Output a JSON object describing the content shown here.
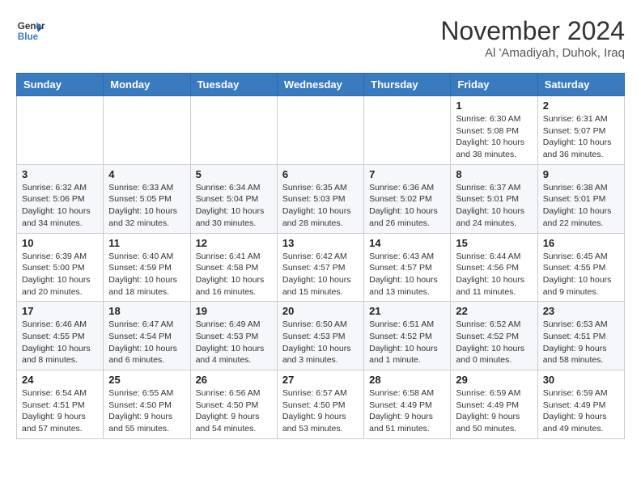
{
  "header": {
    "logo_line1": "General",
    "logo_line2": "Blue",
    "month_title": "November 2024",
    "subtitle": "Al 'Amadiyah, Duhok, Iraq"
  },
  "weekdays": [
    "Sunday",
    "Monday",
    "Tuesday",
    "Wednesday",
    "Thursday",
    "Friday",
    "Saturday"
  ],
  "weeks": [
    [
      {
        "day": "",
        "info": ""
      },
      {
        "day": "",
        "info": ""
      },
      {
        "day": "",
        "info": ""
      },
      {
        "day": "",
        "info": ""
      },
      {
        "day": "",
        "info": ""
      },
      {
        "day": "1",
        "info": "Sunrise: 6:30 AM\nSunset: 5:08 PM\nDaylight: 10 hours and 38 minutes."
      },
      {
        "day": "2",
        "info": "Sunrise: 6:31 AM\nSunset: 5:07 PM\nDaylight: 10 hours and 36 minutes."
      }
    ],
    [
      {
        "day": "3",
        "info": "Sunrise: 6:32 AM\nSunset: 5:06 PM\nDaylight: 10 hours and 34 minutes."
      },
      {
        "day": "4",
        "info": "Sunrise: 6:33 AM\nSunset: 5:05 PM\nDaylight: 10 hours and 32 minutes."
      },
      {
        "day": "5",
        "info": "Sunrise: 6:34 AM\nSunset: 5:04 PM\nDaylight: 10 hours and 30 minutes."
      },
      {
        "day": "6",
        "info": "Sunrise: 6:35 AM\nSunset: 5:03 PM\nDaylight: 10 hours and 28 minutes."
      },
      {
        "day": "7",
        "info": "Sunrise: 6:36 AM\nSunset: 5:02 PM\nDaylight: 10 hours and 26 minutes."
      },
      {
        "day": "8",
        "info": "Sunrise: 6:37 AM\nSunset: 5:01 PM\nDaylight: 10 hours and 24 minutes."
      },
      {
        "day": "9",
        "info": "Sunrise: 6:38 AM\nSunset: 5:01 PM\nDaylight: 10 hours and 22 minutes."
      }
    ],
    [
      {
        "day": "10",
        "info": "Sunrise: 6:39 AM\nSunset: 5:00 PM\nDaylight: 10 hours and 20 minutes."
      },
      {
        "day": "11",
        "info": "Sunrise: 6:40 AM\nSunset: 4:59 PM\nDaylight: 10 hours and 18 minutes."
      },
      {
        "day": "12",
        "info": "Sunrise: 6:41 AM\nSunset: 4:58 PM\nDaylight: 10 hours and 16 minutes."
      },
      {
        "day": "13",
        "info": "Sunrise: 6:42 AM\nSunset: 4:57 PM\nDaylight: 10 hours and 15 minutes."
      },
      {
        "day": "14",
        "info": "Sunrise: 6:43 AM\nSunset: 4:57 PM\nDaylight: 10 hours and 13 minutes."
      },
      {
        "day": "15",
        "info": "Sunrise: 6:44 AM\nSunset: 4:56 PM\nDaylight: 10 hours and 11 minutes."
      },
      {
        "day": "16",
        "info": "Sunrise: 6:45 AM\nSunset: 4:55 PM\nDaylight: 10 hours and 9 minutes."
      }
    ],
    [
      {
        "day": "17",
        "info": "Sunrise: 6:46 AM\nSunset: 4:55 PM\nDaylight: 10 hours and 8 minutes."
      },
      {
        "day": "18",
        "info": "Sunrise: 6:47 AM\nSunset: 4:54 PM\nDaylight: 10 hours and 6 minutes."
      },
      {
        "day": "19",
        "info": "Sunrise: 6:49 AM\nSunset: 4:53 PM\nDaylight: 10 hours and 4 minutes."
      },
      {
        "day": "20",
        "info": "Sunrise: 6:50 AM\nSunset: 4:53 PM\nDaylight: 10 hours and 3 minutes."
      },
      {
        "day": "21",
        "info": "Sunrise: 6:51 AM\nSunset: 4:52 PM\nDaylight: 10 hours and 1 minute."
      },
      {
        "day": "22",
        "info": "Sunrise: 6:52 AM\nSunset: 4:52 PM\nDaylight: 10 hours and 0 minutes."
      },
      {
        "day": "23",
        "info": "Sunrise: 6:53 AM\nSunset: 4:51 PM\nDaylight: 9 hours and 58 minutes."
      }
    ],
    [
      {
        "day": "24",
        "info": "Sunrise: 6:54 AM\nSunset: 4:51 PM\nDaylight: 9 hours and 57 minutes."
      },
      {
        "day": "25",
        "info": "Sunrise: 6:55 AM\nSunset: 4:50 PM\nDaylight: 9 hours and 55 minutes."
      },
      {
        "day": "26",
        "info": "Sunrise: 6:56 AM\nSunset: 4:50 PM\nDaylight: 9 hours and 54 minutes."
      },
      {
        "day": "27",
        "info": "Sunrise: 6:57 AM\nSunset: 4:50 PM\nDaylight: 9 hours and 53 minutes."
      },
      {
        "day": "28",
        "info": "Sunrise: 6:58 AM\nSunset: 4:49 PM\nDaylight: 9 hours and 51 minutes."
      },
      {
        "day": "29",
        "info": "Sunrise: 6:59 AM\nSunset: 4:49 PM\nDaylight: 9 hours and 50 minutes."
      },
      {
        "day": "30",
        "info": "Sunrise: 6:59 AM\nSunset: 4:49 PM\nDaylight: 9 hours and 49 minutes."
      }
    ]
  ]
}
